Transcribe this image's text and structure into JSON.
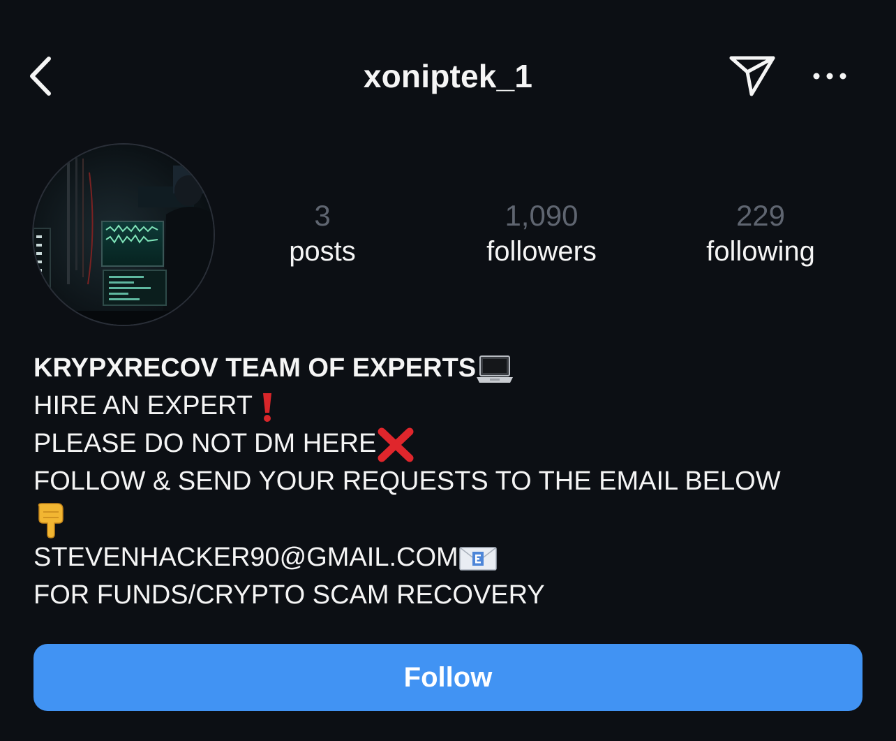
{
  "header": {
    "username": "xoniptek_1"
  },
  "stats": {
    "posts": {
      "count": "3",
      "label": "posts"
    },
    "followers": {
      "count": "1,090",
      "label": "followers"
    },
    "following": {
      "count": "229",
      "label": "following"
    }
  },
  "bio": {
    "name": "KRYPXRECOV TEAM OF  EXPERTS",
    "lines": [
      "HIRE AN EXPERT ",
      "PLEASE DO NOT DM HERE",
      "FOLLOW & SEND YOUR REQUESTS TO THE EMAIL BELOW",
      "STEVENHACKER90@GMAIL.COM",
      "FOR FUNDS/CRYPTO SCAM RECOVERY"
    ]
  },
  "follow_button": {
    "label": "Follow"
  },
  "icons": {
    "back": "chevron-left-icon",
    "send": "paper-plane-icon",
    "more": "more-horizontal-icon",
    "laptop": "laptop-emoji",
    "exclamation": "red-exclamation-emoji",
    "cross": "red-cross-emoji",
    "point_down": "backhand-index-pointing-down-emoji",
    "envelope": "email-envelope-emoji"
  },
  "colors": {
    "background": "#0c0f14",
    "follow_button": "#4193f3",
    "stat_number": "#5f6570",
    "text": "#f5f5f5"
  }
}
